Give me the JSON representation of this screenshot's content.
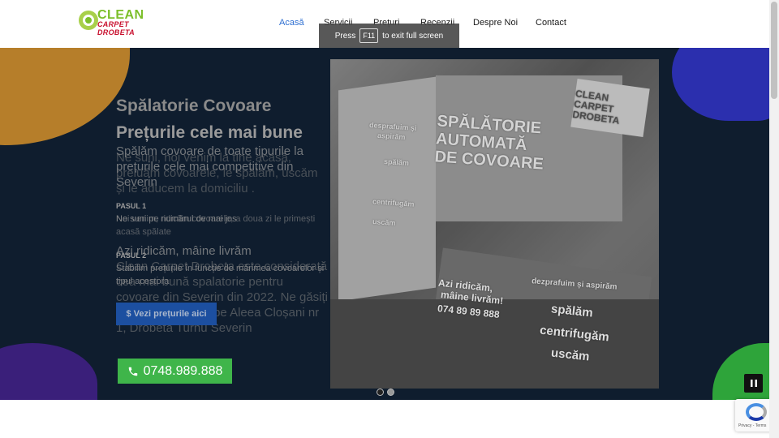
{
  "header": {
    "logo": {
      "line1": "CLEAN",
      "line2": "CARPET DROBETA"
    },
    "nav": [
      {
        "label": "Acasă",
        "active": true
      },
      {
        "label": "Servicii",
        "active": false
      },
      {
        "label": "Prețuri",
        "active": false
      },
      {
        "label": "Recenzii",
        "active": false
      },
      {
        "label": "Despre Noi",
        "active": false
      },
      {
        "label": "Contact",
        "active": false
      }
    ]
  },
  "fullscreen_tip": {
    "press": "Press",
    "key": "F11",
    "rest": "to exit full screen"
  },
  "hero": {
    "title_1": "Spălatorie Covoare",
    "title_2": "Prețurile cele mai bune",
    "desc_a": "Spălăm covoare de toate tipurile la prețurile cele mai competitive din Severin",
    "desc_b": "Ne suni, noi venim la tine acasă, preluăm covoarele, le spălăm, uscăm și le aducem la domiciliu .",
    "step1_label": "PASUL 1",
    "step1_text_a": "Ne suni pe numărul de mai jos",
    "step1_text_b": "Noi venim, ridicăm covoarele, a doua zi le primești acasă spălate",
    "step_mid_text": "Azi ridicăm, mâine livrăm",
    "step2_label": "PASUL 2",
    "step2_text_a": "Stabilim prețurile în funcție de mărimea covoarelor și tipul acestora",
    "step2_text_b": "Clean Carpet Drobeta este considerată cea mai bună spalatorie pentru covoare din Severin din 2022. Ne găsiți la adresa noastră pe Aleea Cloșani nr 1, Drobeta Turnu Severin",
    "cta": "$ Vezi prețurile aici",
    "phone": "0748.989.888"
  },
  "photo": {
    "logo_1": "CLEAN",
    "logo_2": "CARPET",
    "logo_3": "DROBETA",
    "big_1": "SPĂLĂTORIE",
    "big_2": "AUTOMATĂ",
    "big_3": "DE COVOARE",
    "left_1": "desprafuim și",
    "left_2": "aspirăm",
    "left_3": "spălăm",
    "left_4": "centrifugăm",
    "left_5": "uscăm",
    "red_1": "Azi ridicăm,",
    "red_2": "mâine livrăm!",
    "red_3": "074 89 89 888",
    "right_1": "dezprafuim și aspirăm",
    "right_2": "spălăm",
    "right_3": "centrifugăm",
    "right_4": "uscăm"
  },
  "slider": {
    "pause_icon": "pause-icon"
  },
  "recaptcha": {
    "text": "Privacy - Terms"
  }
}
